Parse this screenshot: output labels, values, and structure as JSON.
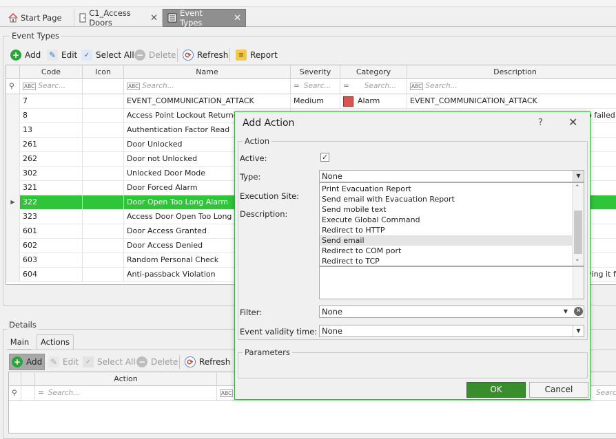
{
  "tabs": [
    {
      "label": "Start Page",
      "icon": "home-icon"
    },
    {
      "label": "C1_Access Doors",
      "icon": "door-icon"
    },
    {
      "label": "Event Types",
      "icon": "event-list-icon"
    }
  ],
  "event_types": {
    "title": "Event Types",
    "toolbar": {
      "add": "Add",
      "edit": "Edit",
      "select_all": "Select All",
      "delete": "Delete",
      "refresh": "Refresh",
      "report": "Report"
    },
    "columns": [
      "Code",
      "Icon",
      "Name",
      "Severity",
      "Category",
      "Description"
    ],
    "filters": {
      "code": "Searc...",
      "name": "Search...",
      "severity": "Searc...",
      "category": "Search...",
      "description": "Search..."
    },
    "rows": [
      {
        "code": "7",
        "name": "EVENT_COMMUNICATION_ATTACK",
        "severity": "Medium",
        "category": "Alarm",
        "description": "EVENT_COMMUNICATION_ATTACK"
      },
      {
        "code": "8",
        "name": "Access Point Lockout Returned",
        "description_tail": "o failed a"
      },
      {
        "code": "13",
        "name": "Authentication Factor Read"
      },
      {
        "code": "261",
        "name": "Door Unlocked"
      },
      {
        "code": "262",
        "name": "Door not Unlocked"
      },
      {
        "code": "302",
        "name": "Unlocked Door Mode"
      },
      {
        "code": "321",
        "name": "Door Forced Alarm"
      },
      {
        "code": "322",
        "name": "Door Open Too Long Alarm"
      },
      {
        "code": "323",
        "name": "Access Door Open Too Long Pre"
      },
      {
        "code": "601",
        "name": "Door Access Granted"
      },
      {
        "code": "602",
        "name": "Door Access Denied"
      },
      {
        "code": "603",
        "name": "Random Personal Check"
      },
      {
        "code": "604",
        "name": "Anti-passback Violation",
        "description_tail": "ving it fi"
      }
    ],
    "category_color": "#d9534f",
    "selected_color": "#2fc43a"
  },
  "details": {
    "title": "Details",
    "tabs": [
      "Main",
      "Actions"
    ],
    "toolbar": {
      "add": "Add",
      "edit": "Edit",
      "select_all": "Select All",
      "delete": "Delete",
      "refresh": "Refresh"
    },
    "columns": [
      "Action"
    ],
    "filter": "Search...",
    "filter_right": "Search"
  },
  "dialog": {
    "title": "Add Action",
    "help": "?",
    "close": "✕",
    "action_group": "Action",
    "active_label": "Active:",
    "type_label": "Type:",
    "type_value": "None",
    "execution_site_label": "Execution Site:",
    "description_label": "Description:",
    "type_options": [
      "Print Evacuation Report",
      "Send email with Evacuation Report",
      "Send mobile text",
      "Execute Global Command",
      "Redirect to HTTP",
      "Send email",
      "Redirect to COM port",
      "Redirect to TCP"
    ],
    "highlighted_option": "Send email",
    "filter_label": "Filter:",
    "filter_value": "None",
    "validity_label": "Event validity time:",
    "validity_value": "None",
    "parameters_group": "Parameters",
    "ok": "OK",
    "cancel": "Cancel"
  }
}
